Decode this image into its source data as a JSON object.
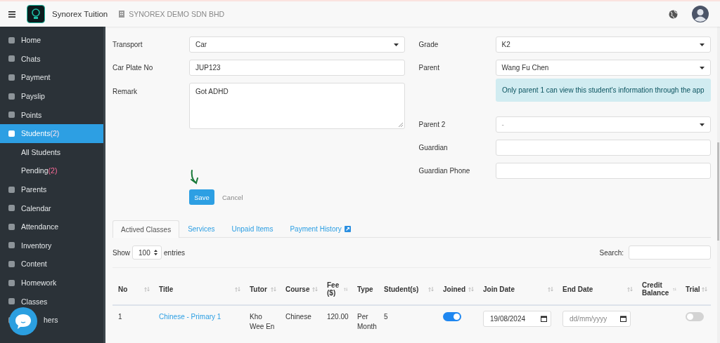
{
  "topbar": {
    "app_name": "Synorex Tuition",
    "company": "SYNOREX DEMO SDN BHD"
  },
  "sidebar": {
    "items": [
      {
        "label": "Home",
        "selected": false
      },
      {
        "label": "Chats",
        "selected": false
      },
      {
        "label": "Payment",
        "selected": false
      },
      {
        "label": "Payslip",
        "selected": false
      },
      {
        "label": "Points",
        "selected": false
      },
      {
        "label": "Students",
        "count": "(2)",
        "selected": true,
        "children": [
          {
            "label": "All Students"
          },
          {
            "label": "Pending",
            "count": "(2)"
          }
        ]
      },
      {
        "label": "Parents",
        "selected": false
      },
      {
        "label": "Calendar",
        "selected": false
      },
      {
        "label": "Attendance",
        "selected": false
      },
      {
        "label": "Inventory",
        "selected": false
      },
      {
        "label": "Content",
        "selected": false
      },
      {
        "label": "Homework",
        "selected": false
      },
      {
        "label": "Classes",
        "selected": false
      },
      {
        "label": "hers",
        "selected": false
      }
    ]
  },
  "form_left": [
    {
      "kind": "select",
      "label": "Transport",
      "value": "Car"
    },
    {
      "kind": "text",
      "label": "Car Plate No",
      "value": "JUP123"
    },
    {
      "kind": "textarea",
      "label": "Remark",
      "value": "Got ADHD"
    }
  ],
  "form_right": [
    {
      "kind": "select",
      "label": "Grade",
      "value": "K2"
    },
    {
      "kind": "select",
      "label": "Parent",
      "value": "Wang Fu Chen"
    },
    {
      "kind": "alert",
      "value": "Only parent 1 can view this student's information through the app"
    },
    {
      "kind": "select",
      "label": "Parent 2",
      "placeholder": "-"
    },
    {
      "kind": "text",
      "label": "Guardian"
    },
    {
      "kind": "text",
      "label": "Guardian Phone"
    }
  ],
  "buttons": {
    "save": "Save",
    "cancel": "Cancel"
  },
  "tabs": [
    {
      "label": "Actived Classes",
      "selected": true
    },
    {
      "label": "Services",
      "selected": false
    },
    {
      "label": "Unpaid Items",
      "selected": false
    },
    {
      "label": "Payment History",
      "selected": false,
      "external": true
    }
  ],
  "length_menu": {
    "show": "Show",
    "value": "100",
    "entries": "entries"
  },
  "search": {
    "label": "Search:"
  },
  "table": {
    "columns": [
      "No",
      "Title",
      "Tutor",
      "Course",
      "Fee ($)",
      "Type",
      "Student(s)",
      "Joined",
      "Join Date",
      "End Date",
      "Credit Balance",
      "Trial"
    ],
    "rows": [
      {
        "no": "1",
        "title": "Chinese - Primary 1",
        "tutor": "Kho Wee En",
        "course": "Chinese",
        "fee": "120.00",
        "type": "Per Month",
        "students": "5",
        "joined": true,
        "join_date": "19/08/2024",
        "end_date_placeholder": "dd/mm/yyyy",
        "trial": false
      }
    ]
  }
}
